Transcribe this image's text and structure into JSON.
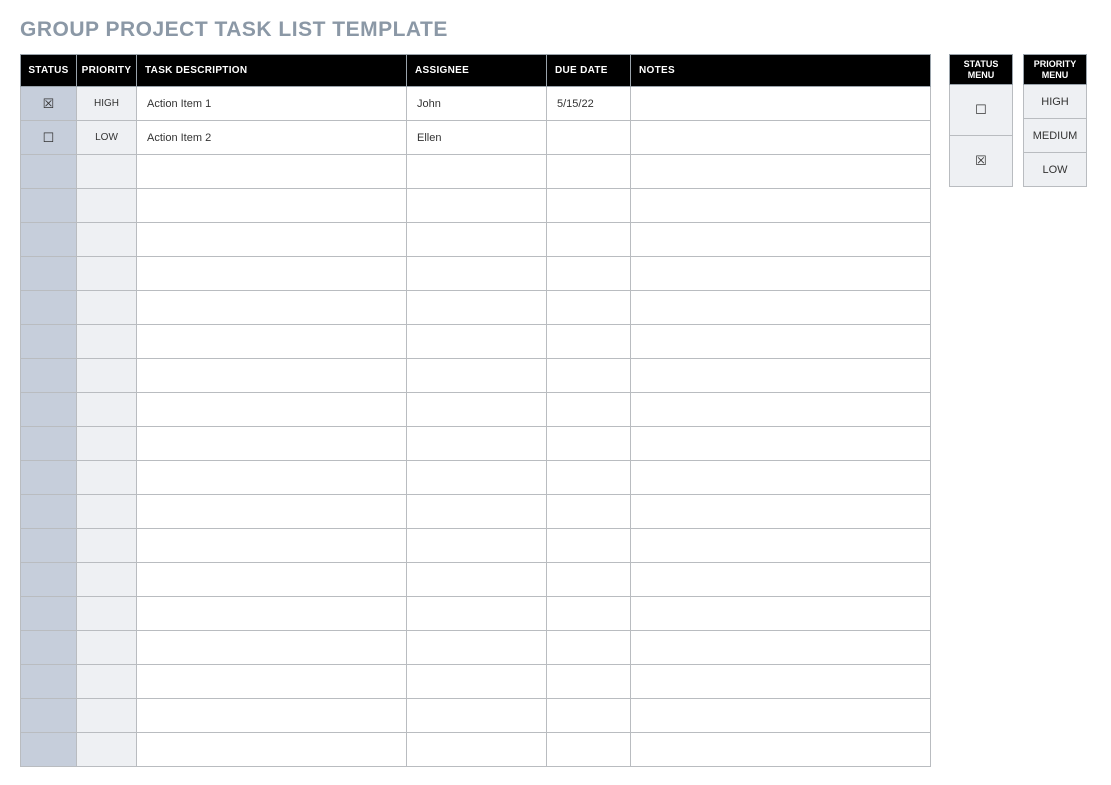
{
  "title": "GROUP PROJECT TASK LIST TEMPLATE",
  "headers": {
    "status": "STATUS",
    "priority": "PRIORITY",
    "task": "TASK DESCRIPTION",
    "assignee": "ASSIGNEE",
    "due": "DUE DATE",
    "notes": "NOTES"
  },
  "rows": [
    {
      "status": "☒",
      "priority": "HIGH",
      "task": "Action Item 1",
      "assignee": "John",
      "due": "5/15/22",
      "notes": ""
    },
    {
      "status": "☐",
      "priority": "LOW",
      "task": "Action Item 2",
      "assignee": "Ellen",
      "due": "",
      "notes": ""
    },
    {
      "status": "",
      "priority": "",
      "task": "",
      "assignee": "",
      "due": "",
      "notes": ""
    },
    {
      "status": "",
      "priority": "",
      "task": "",
      "assignee": "",
      "due": "",
      "notes": ""
    },
    {
      "status": "",
      "priority": "",
      "task": "",
      "assignee": "",
      "due": "",
      "notes": ""
    },
    {
      "status": "",
      "priority": "",
      "task": "",
      "assignee": "",
      "due": "",
      "notes": ""
    },
    {
      "status": "",
      "priority": "",
      "task": "",
      "assignee": "",
      "due": "",
      "notes": ""
    },
    {
      "status": "",
      "priority": "",
      "task": "",
      "assignee": "",
      "due": "",
      "notes": ""
    },
    {
      "status": "",
      "priority": "",
      "task": "",
      "assignee": "",
      "due": "",
      "notes": ""
    },
    {
      "status": "",
      "priority": "",
      "task": "",
      "assignee": "",
      "due": "",
      "notes": ""
    },
    {
      "status": "",
      "priority": "",
      "task": "",
      "assignee": "",
      "due": "",
      "notes": ""
    },
    {
      "status": "",
      "priority": "",
      "task": "",
      "assignee": "",
      "due": "",
      "notes": ""
    },
    {
      "status": "",
      "priority": "",
      "task": "",
      "assignee": "",
      "due": "",
      "notes": ""
    },
    {
      "status": "",
      "priority": "",
      "task": "",
      "assignee": "",
      "due": "",
      "notes": ""
    },
    {
      "status": "",
      "priority": "",
      "task": "",
      "assignee": "",
      "due": "",
      "notes": ""
    },
    {
      "status": "",
      "priority": "",
      "task": "",
      "assignee": "",
      "due": "",
      "notes": ""
    },
    {
      "status": "",
      "priority": "",
      "task": "",
      "assignee": "",
      "due": "",
      "notes": ""
    },
    {
      "status": "",
      "priority": "",
      "task": "",
      "assignee": "",
      "due": "",
      "notes": ""
    },
    {
      "status": "",
      "priority": "",
      "task": "",
      "assignee": "",
      "due": "",
      "notes": ""
    },
    {
      "status": "",
      "priority": "",
      "task": "",
      "assignee": "",
      "due": "",
      "notes": ""
    }
  ],
  "status_menu": {
    "header_l1": "STATUS",
    "header_l2": "MENU",
    "items": [
      "☐",
      "☒"
    ]
  },
  "priority_menu": {
    "header_l1": "PRIORITY",
    "header_l2": "MENU",
    "items": [
      "HIGH",
      "MEDIUM",
      "LOW"
    ]
  }
}
